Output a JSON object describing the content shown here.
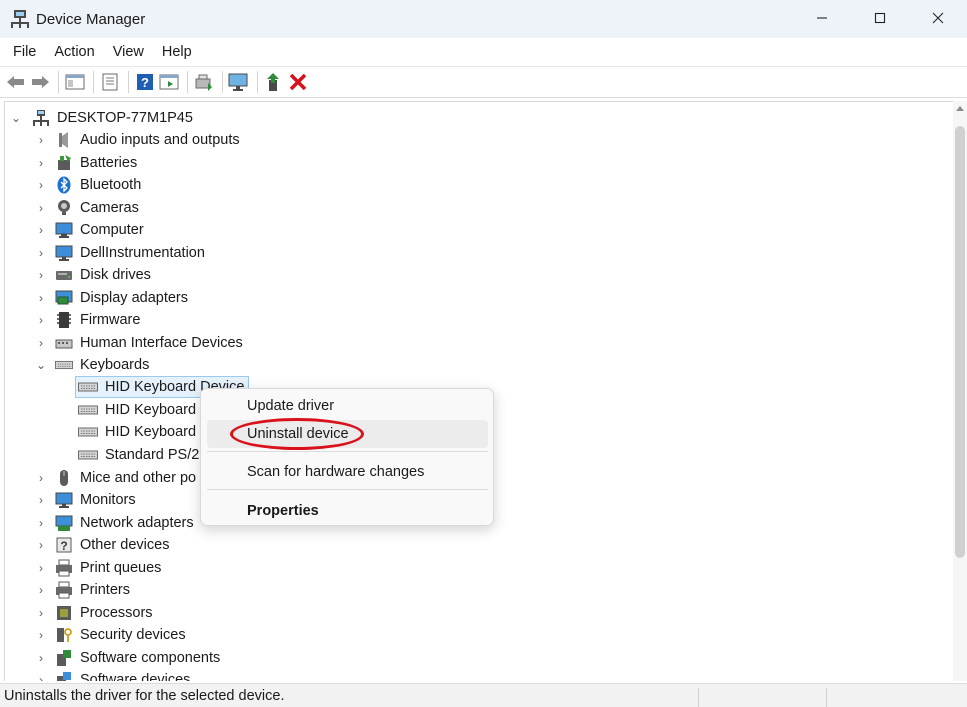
{
  "window": {
    "title": "Device Manager",
    "app_icon": "device-manager-icon",
    "controls": [
      "minimize-icon",
      "maximize-icon",
      "close-icon"
    ]
  },
  "menu": {
    "items": [
      {
        "label": "File"
      },
      {
        "label": "Action"
      },
      {
        "label": "View"
      },
      {
        "label": "Help"
      }
    ]
  },
  "toolbar": {
    "buttons": [
      "back-icon",
      "forward-icon",
      "show-hide-console-tree-icon",
      "properties-icon",
      "help-icon",
      "show-action-pane-icon",
      "update-driver-icon",
      "scan-hardware-icon",
      "enable-device-icon",
      "uninstall-device-icon"
    ],
    "colors": {
      "uninstall": "#d8111b",
      "help": "#1f5fb3"
    }
  },
  "tree": {
    "root": {
      "label": "DESKTOP-77M1P45",
      "expanded": true
    },
    "categories": [
      {
        "label": "Audio inputs and outputs",
        "icon": "speaker-icon"
      },
      {
        "label": "Batteries",
        "icon": "battery-icon"
      },
      {
        "label": "Bluetooth",
        "icon": "bluetooth-icon"
      },
      {
        "label": "Cameras",
        "icon": "camera-icon"
      },
      {
        "label": "Computer",
        "icon": "computer-icon"
      },
      {
        "label": "DellInstrumentation",
        "icon": "monitor-icon"
      },
      {
        "label": "Disk drives",
        "icon": "disk-drive-icon"
      },
      {
        "label": "Display adapters",
        "icon": "display-adapter-icon"
      },
      {
        "label": "Firmware",
        "icon": "firmware-chip-icon"
      },
      {
        "label": "Human Interface Devices",
        "icon": "hid-icon"
      },
      {
        "label": "Keyboards",
        "icon": "keyboard-icon",
        "expanded": true
      },
      {
        "label": "Mice and other po",
        "icon": "mouse-icon"
      },
      {
        "label": "Monitors",
        "icon": "monitor-icon"
      },
      {
        "label": "Network adapters",
        "icon": "network-adapter-icon"
      },
      {
        "label": "Other devices",
        "icon": "unknown-device-icon"
      },
      {
        "label": "Print queues",
        "icon": "print-queue-icon"
      },
      {
        "label": "Printers",
        "icon": "printer-icon"
      },
      {
        "label": "Processors",
        "icon": "processor-icon"
      },
      {
        "label": "Security devices",
        "icon": "security-device-icon"
      },
      {
        "label": "Software components",
        "icon": "software-component-icon"
      },
      {
        "label": "Software devices",
        "icon": "software-device-icon"
      }
    ],
    "keyboard_children": [
      {
        "label": "HID Keyboard Device",
        "selected": true
      },
      {
        "label": "HID Keyboard"
      },
      {
        "label": "HID Keyboard"
      },
      {
        "label": "Standard PS/2"
      }
    ]
  },
  "context_menu": {
    "items": [
      {
        "label": "Update driver"
      },
      {
        "label": "Uninstall device",
        "hover": true,
        "highlighted": true
      },
      {
        "label": "Scan for hardware changes"
      },
      {
        "label": "Properties",
        "bold": true
      }
    ],
    "highlight_color": "#d8111b"
  },
  "status_bar": {
    "text": "Uninstalls the driver for the selected device."
  }
}
